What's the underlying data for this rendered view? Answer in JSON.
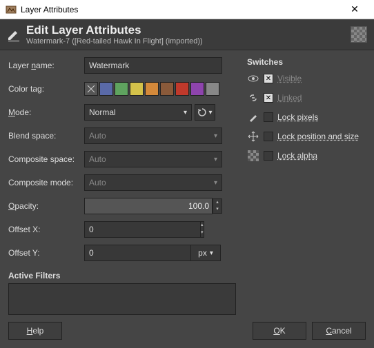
{
  "window": {
    "title": "Layer Attributes"
  },
  "header": {
    "title": "Edit Layer Attributes",
    "subtitle": "Watermark-7 ([Red-tailed Hawk In Flight] (imported))"
  },
  "labels": {
    "layer_name": "Layer name:",
    "color_tag": "Color tag:",
    "mode": "Mode:",
    "blend_space": "Blend space:",
    "composite_space": "Composite space:",
    "composite_mode": "Composite mode:",
    "opacity": "Opacity:",
    "offset_x": "Offset X:",
    "offset_y": "Offset Y:",
    "active_filters": "Active Filters"
  },
  "values": {
    "layer_name": "Watermark",
    "mode": "Normal",
    "blend_space": "Auto",
    "composite_space": "Auto",
    "composite_mode": "Auto",
    "opacity": "100.0",
    "offset_x": "0",
    "offset_y": "0",
    "offset_unit": "px"
  },
  "color_tags": [
    "none",
    "#5a6aa8",
    "#5fa35f",
    "#d4c24a",
    "#d4893a",
    "#8a5a3a",
    "#c0392b",
    "#8e44ad",
    "#888888"
  ],
  "switches": {
    "heading": "Switches",
    "items": [
      {
        "icon": "eye",
        "checked": true,
        "label": "Visible",
        "disabled": true
      },
      {
        "icon": "link",
        "checked": true,
        "label": "Linked",
        "disabled": true
      },
      {
        "icon": "brush",
        "checked": false,
        "label": "Lock pixels",
        "disabled": false
      },
      {
        "icon": "move",
        "checked": false,
        "label": "Lock position and size",
        "disabled": false
      },
      {
        "icon": "alpha",
        "checked": false,
        "label": "Lock alpha",
        "disabled": false
      }
    ]
  },
  "buttons": {
    "help": "Help",
    "ok": "OK",
    "cancel": "Cancel"
  }
}
